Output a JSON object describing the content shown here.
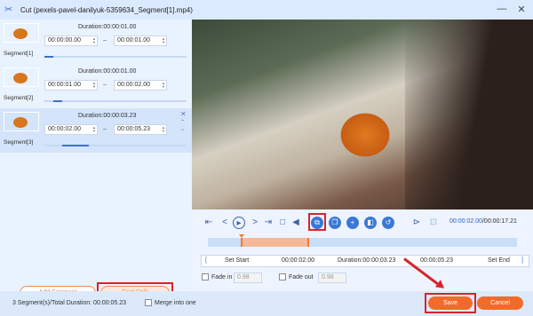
{
  "window": {
    "title": "Cut (pexels-pavel-danilyuk-5359634_Segment[1].mp4)"
  },
  "segments": [
    {
      "label": "Segment[1]",
      "duration": "Duration:00:00:01.00",
      "start": "00:00:00.00",
      "end": "00:00:01.00",
      "selected": false
    },
    {
      "label": "Segment[2]",
      "duration": "Duration:00:00:01.00",
      "start": "00:00:01.00",
      "end": "00:00:02.00",
      "selected": false
    },
    {
      "label": "Segment[3]",
      "duration": "Duration:00:00:03.23",
      "start": "00:00:02.00",
      "end": "00:00:05.23",
      "selected": true
    }
  ],
  "buttons": {
    "add_segment": "Add Segment",
    "fast_split": "Fast Split",
    "save": "Save",
    "cancel": "Cancel"
  },
  "playback": {
    "current": "00:00:02.00",
    "total": "/00:00:17.21"
  },
  "set_row": {
    "set_start": "Set Start",
    "start": "00:00:02.00",
    "duration": "Duration:00:00:03.23",
    "end": "00:00:05.23",
    "set_end": "Set End"
  },
  "fade": {
    "fade_in_label": "Fade in",
    "fade_in_value": "0.98",
    "fade_out_label": "Fade out",
    "fade_out_value": "0.98"
  },
  "footer": {
    "status": "3 Segment(s)/Total Duration: 00:00:05.23",
    "merge_label": "Merge into one"
  },
  "colors": {
    "accent": "#f26b2a",
    "highlight": "#d9232b",
    "primary": "#3a78d6"
  }
}
